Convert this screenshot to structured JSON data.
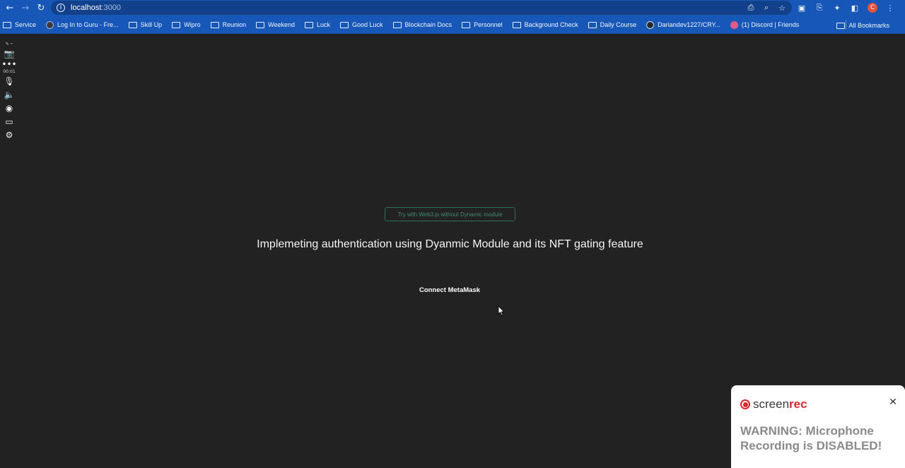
{
  "browser": {
    "url_host": "localhost",
    "url_port": ":3000",
    "profile_initial": "C"
  },
  "bookmarks": [
    {
      "label": "Service",
      "icon": "folder-icon"
    },
    {
      "label": "Log In to Guru - Fre...",
      "icon": "guru-icon"
    },
    {
      "label": "Skill Up",
      "icon": "folder-icon"
    },
    {
      "label": "Wipro",
      "icon": "folder-icon"
    },
    {
      "label": "Reunion",
      "icon": "folder-icon"
    },
    {
      "label": "Weekend",
      "icon": "folder-icon"
    },
    {
      "label": "Luck",
      "icon": "folder-icon"
    },
    {
      "label": "Good Luck",
      "icon": "folder-icon"
    },
    {
      "label": "Blockchain Docs",
      "icon": "folder-icon"
    },
    {
      "label": "Personnel",
      "icon": "folder-icon"
    },
    {
      "label": "Background Check",
      "icon": "folder-icon"
    },
    {
      "label": "Daily Course",
      "icon": "folder-icon"
    },
    {
      "label": "Dariandev1227/CRY...",
      "icon": "github-icon"
    },
    {
      "label": "(1) Discord | Friends",
      "icon": "discord-icon"
    }
  ],
  "all_bookmarks_label": "All Bookmarks",
  "recorder": {
    "timer": "00:01"
  },
  "main": {
    "web3_link": "Try with Web3.js without Dynamic module",
    "heading": "Implemeting authentication using Dyanmic Module and its NFT gating feature",
    "connect_button": "Connect MetaMask"
  },
  "toast": {
    "brand_a": "screen",
    "brand_b": "rec",
    "message": "WARNING: Microphone Recording is DISABLED!"
  },
  "colors": {
    "background": "#222222",
    "browser_bar": "#1757b8",
    "screenrec_red": "#d9272e",
    "link_green": "#3f8a76"
  }
}
